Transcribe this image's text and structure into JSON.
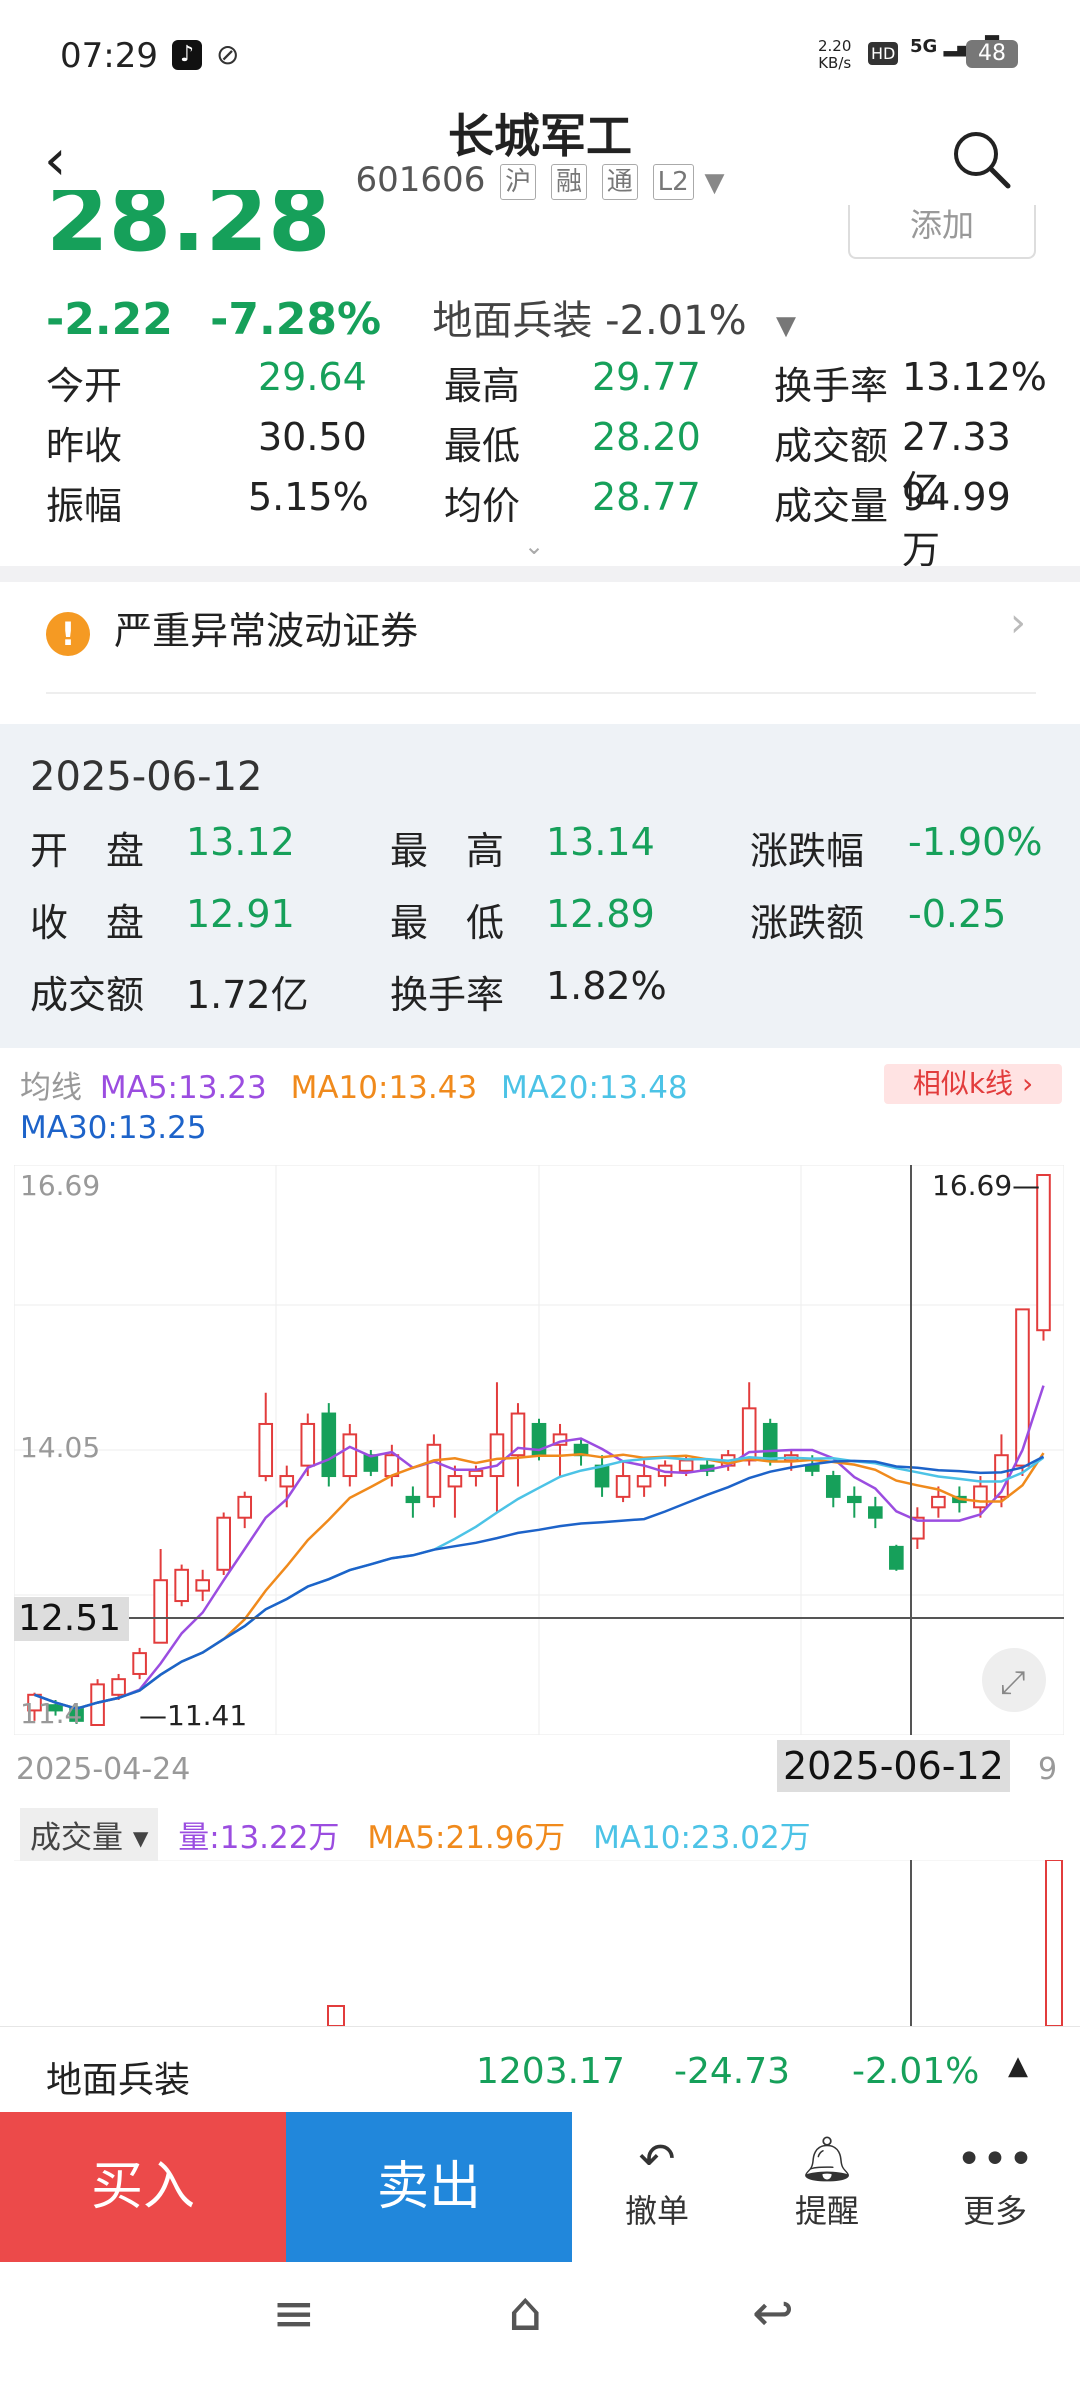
{
  "status_bar": {
    "time": "07:29",
    "speed": "2.20",
    "speed_unit": "KB/s",
    "network": "5G",
    "battery": "48"
  },
  "header": {
    "title": "长城军工",
    "code": "601606",
    "tags": [
      "沪",
      "融",
      "通",
      "L2"
    ]
  },
  "quote": {
    "price": "28.28",
    "change": "-2.22",
    "change_pct": "-7.28%",
    "sector_name": "地面兵装",
    "sector_pct": "-2.01%",
    "add_label": "添加"
  },
  "stats": {
    "open_label": "今开",
    "open": "29.64",
    "high_label": "最高",
    "high": "29.77",
    "turnover_label": "换手率",
    "turnover": "13.12%",
    "prev_label": "昨收",
    "prev": "30.50",
    "low_label": "最低",
    "low": "28.20",
    "amount_label": "成交额",
    "amount": "27.33亿",
    "amplitude_label": "振幅",
    "amplitude": "5.15%",
    "avg_label": "均价",
    "avg": "28.77",
    "volume_label": "成交量",
    "volume": "94.99万"
  },
  "alert": {
    "text": "严重异常波动证券"
  },
  "detail": {
    "date": "2025-06-12",
    "open_label": "开　盘",
    "open": "13.12",
    "high_label": "最　高",
    "high": "13.14",
    "pct_label": "涨跌幅",
    "pct": "-1.90%",
    "close_label": "收　盘",
    "close": "12.91",
    "low_label": "最　低",
    "low": "12.89",
    "chg_label": "涨跌额",
    "chg": "-0.25",
    "amount_label": "成交额",
    "amount": "1.72亿",
    "turnover_label": "换手率",
    "turnover": "1.82%"
  },
  "ma": {
    "label": "均线",
    "ma5": "MA5:13.23",
    "ma10": "MA10:13.43",
    "ma20": "MA20:13.48",
    "ma30": "MA30:13.25",
    "similar_label": "相似k线",
    "colors": {
      "ma5": "#9b4de0",
      "ma10": "#f08a1c",
      "ma20": "#4cc3e6",
      "ma30": "#1d63c9"
    }
  },
  "chart_data": {
    "type": "candlestick",
    "y_top_label": "16.69",
    "y_mid_label": "14.05",
    "y_low_label": "11.41",
    "max_price": 16.69,
    "min_price": 11.41,
    "crosshair_price": "12.51",
    "crosshair_date": "2025-06-12",
    "start_date": "2025-04-24",
    "end_date_partial": "9",
    "candles": [
      [
        11.55,
        11.7,
        11.45,
        11.72
      ],
      [
        11.6,
        11.55,
        11.5,
        11.65
      ],
      [
        11.58,
        11.45,
        11.42,
        11.62
      ],
      [
        11.41,
        11.8,
        11.41,
        11.85
      ],
      [
        11.7,
        11.85,
        11.65,
        11.9
      ],
      [
        11.9,
        12.1,
        11.85,
        12.15
      ],
      [
        12.2,
        12.8,
        12.2,
        13.1
      ],
      [
        12.6,
        12.9,
        12.55,
        12.95
      ],
      [
        12.7,
        12.8,
        12.6,
        12.9
      ],
      [
        12.9,
        13.4,
        12.85,
        13.45
      ],
      [
        13.4,
        13.6,
        13.3,
        13.65
      ],
      [
        13.8,
        14.3,
        13.75,
        14.6
      ],
      [
        13.7,
        13.8,
        13.5,
        13.9
      ],
      [
        13.9,
        14.3,
        13.8,
        14.4
      ],
      [
        14.4,
        13.8,
        13.7,
        14.5
      ],
      [
        13.8,
        14.2,
        13.7,
        14.3
      ],
      [
        14.0,
        13.85,
        13.8,
        14.05
      ],
      [
        13.8,
        14.0,
        13.7,
        14.1
      ],
      [
        13.6,
        13.55,
        13.4,
        13.7
      ],
      [
        13.6,
        14.1,
        13.5,
        14.2
      ],
      [
        13.7,
        13.8,
        13.4,
        13.9
      ],
      [
        13.8,
        13.85,
        13.7,
        13.9
      ],
      [
        13.8,
        14.2,
        13.45,
        14.7
      ],
      [
        14.0,
        14.4,
        13.7,
        14.5
      ],
      [
        14.3,
        14.0,
        13.95,
        14.35
      ],
      [
        14.1,
        14.2,
        13.8,
        14.3
      ],
      [
        14.1,
        14.0,
        13.9,
        14.15
      ],
      [
        13.9,
        13.7,
        13.6,
        14.0
      ],
      [
        13.6,
        13.8,
        13.55,
        13.95
      ],
      [
        13.7,
        13.8,
        13.6,
        13.95
      ],
      [
        13.8,
        13.9,
        13.7,
        13.95
      ],
      [
        13.85,
        13.95,
        13.8,
        14.0
      ],
      [
        13.9,
        13.85,
        13.8,
        13.95
      ],
      [
        13.9,
        14.0,
        13.85,
        14.05
      ],
      [
        13.95,
        14.45,
        13.9,
        14.7
      ],
      [
        14.3,
        13.95,
        13.9,
        14.35
      ],
      [
        13.95,
        14.0,
        13.85,
        14.05
      ],
      [
        13.9,
        13.85,
        13.8,
        14.0
      ],
      [
        13.8,
        13.6,
        13.5,
        13.85
      ],
      [
        13.6,
        13.55,
        13.4,
        13.7
      ],
      [
        13.5,
        13.4,
        13.3,
        13.6
      ],
      [
        13.12,
        12.91,
        12.89,
        13.14
      ],
      [
        13.2,
        13.4,
        13.1,
        13.5
      ],
      [
        13.5,
        13.6,
        13.4,
        13.7
      ],
      [
        13.6,
        13.55,
        13.45,
        13.7
      ],
      [
        13.5,
        13.7,
        13.4,
        13.8
      ],
      [
        13.6,
        14.0,
        13.5,
        14.2
      ],
      [
        13.9,
        15.4,
        13.8,
        15.4
      ],
      [
        15.2,
        16.69,
        15.1,
        16.69
      ]
    ]
  },
  "volume": {
    "label": "成交量",
    "vol": "量:13.22万",
    "ma5": "MA5:21.96万",
    "ma10": "MA10:23.02万"
  },
  "index_bar": {
    "name": "地面兵装",
    "value": "1203.17",
    "change": "-24.73",
    "pct": "-2.01%"
  },
  "bottom": {
    "buy": "买入",
    "sell": "卖出",
    "cancel": "撤单",
    "alert": "提醒",
    "more": "更多"
  }
}
